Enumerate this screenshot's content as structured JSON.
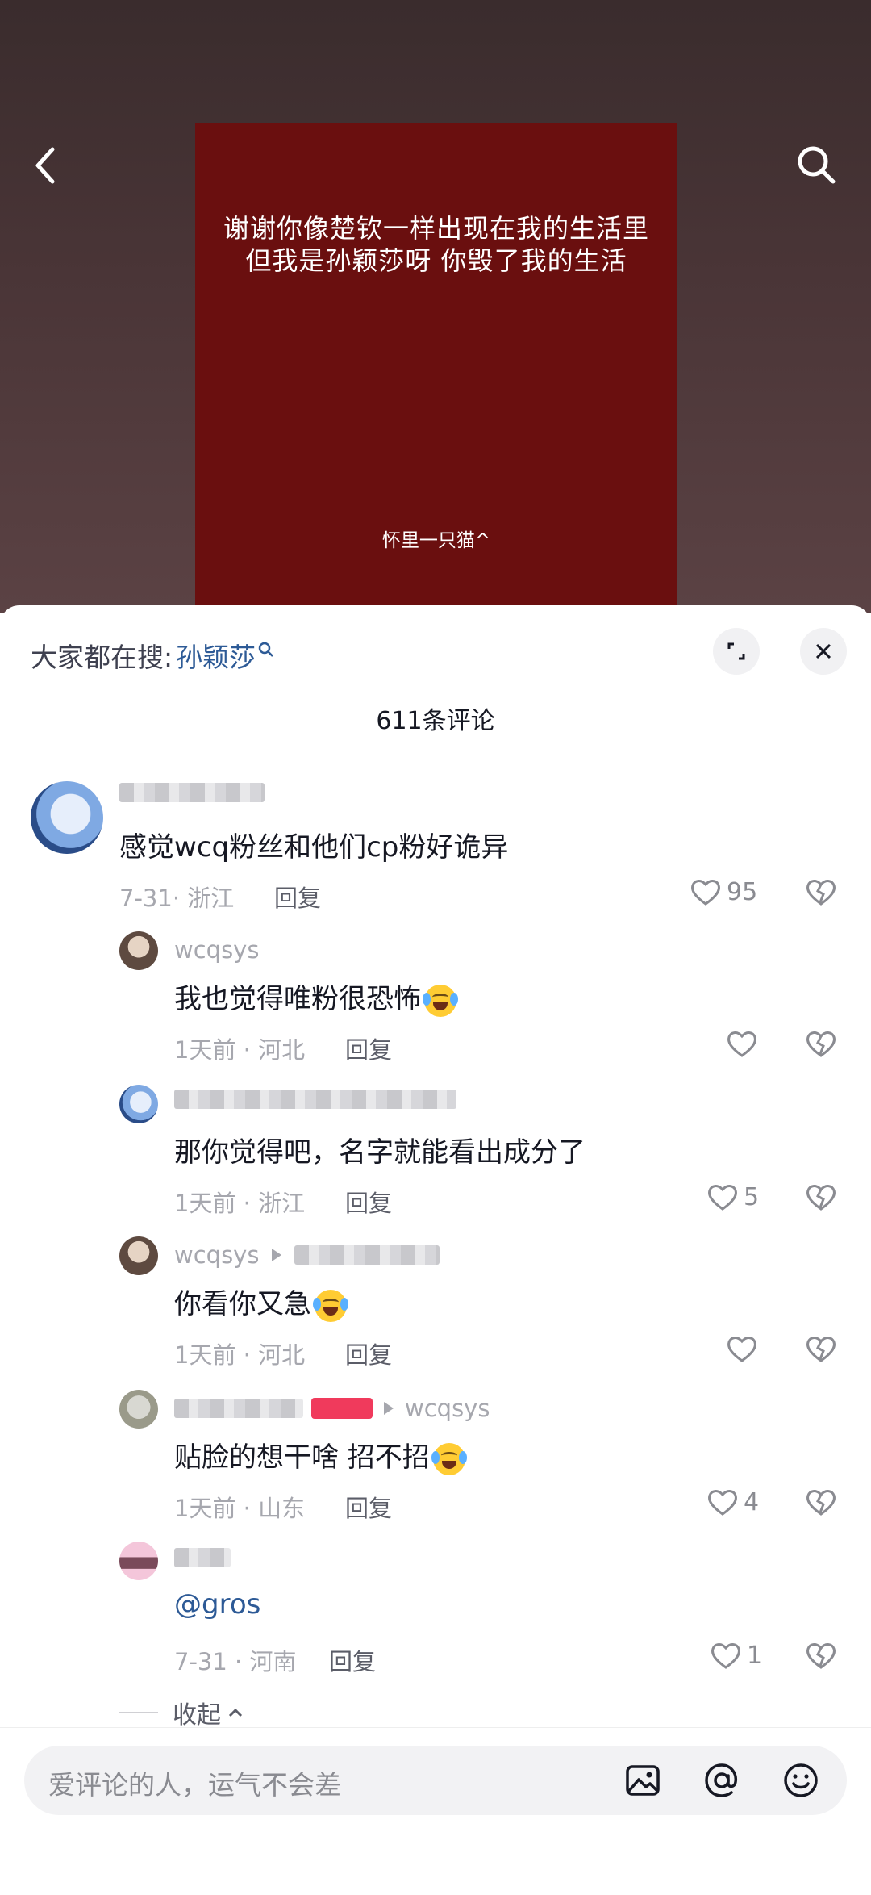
{
  "video": {
    "poster_line1": "谢谢你像楚钦一样出现在我的生活里",
    "poster_line2": "但我是孙颖莎呀 你毁了我的生活",
    "poster_signature": "怀里一只猫^",
    "poster_color": "#6a0f0f"
  },
  "sheet": {
    "search_prefix": "大家都在搜:",
    "search_keyword": "孙颖莎",
    "comment_count": "611条评论"
  },
  "comments": [
    {
      "username": "",
      "text": "感觉wcq粉丝和他们cp粉好诡异",
      "date": "7-31",
      "region": "浙江",
      "reply": "回复",
      "likes": "95"
    },
    {
      "username": "wcqsys",
      "text": "我也觉得唯粉很恐怖",
      "date": "1天前",
      "region": "河北",
      "reply": "回复",
      "likes": ""
    },
    {
      "username": "",
      "text": "那你觉得吧，名字就能看出成分了",
      "date": "1天前",
      "region": "浙江",
      "reply": "回复",
      "likes": "5"
    },
    {
      "username": "wcqsys",
      "reply_to": "",
      "text": "你看你又急",
      "date": "1天前",
      "region": "河北",
      "reply": "回复",
      "likes": ""
    },
    {
      "username": "",
      "reply_to": "wcqsys",
      "text": "贴脸的想干啥 招不招",
      "date": "1天前",
      "region": "山东",
      "reply": "回复",
      "likes": "4"
    },
    {
      "username": "",
      "text": "@gros",
      "date": "7-31",
      "region": "河南",
      "reply": "回复",
      "likes": "1"
    }
  ],
  "collapse_label": "收起",
  "input": {
    "placeholder": "爱评论的人，运气不会差"
  },
  "colors": {
    "accent": "#2d5a96",
    "mention": "#2d5a96"
  }
}
